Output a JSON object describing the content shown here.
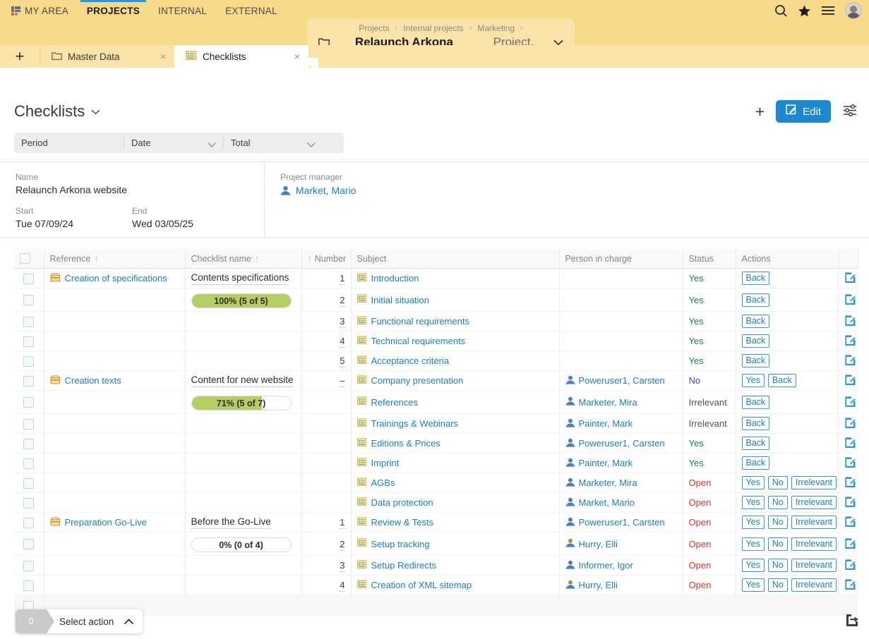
{
  "topnav": {
    "items": [
      {
        "label": "MY AREA",
        "icon": "myarea-icon",
        "active": false
      },
      {
        "label": "PROJECTS",
        "active": true
      },
      {
        "label": "INTERNAL",
        "active": false
      },
      {
        "label": "EXTERNAL",
        "active": false
      }
    ],
    "icons": [
      "search-icon",
      "star-icon",
      "menu-icon",
      "avatar"
    ]
  },
  "breadcrumb": {
    "path": [
      "Projects",
      "Internal projects",
      "Marketing"
    ],
    "separator": "›",
    "title": "Relaunch Arkona website",
    "subtitle": "Project, Open",
    "chevron": "⌄"
  },
  "tabs": {
    "add_label": "+",
    "items": [
      {
        "label": "Master Data",
        "icon": "folder-icon",
        "active": false,
        "close": "×"
      },
      {
        "label": "Checklists",
        "icon": "checklist-icon",
        "active": true,
        "close": "×"
      }
    ]
  },
  "page": {
    "title": "Checklists",
    "title_chevron": "⌄",
    "plus_label": "+",
    "edit_label": "Edit"
  },
  "filters": {
    "label": "Period",
    "date_value": "Date",
    "total_value": "Total"
  },
  "info": {
    "name_label": "Name",
    "name_value": "Relaunch Arkona website",
    "start_label": "Start",
    "start_value": "Tue 07/09/24",
    "end_label": "End",
    "end_value": "Wed 03/05/25",
    "pm_label": "Project manager",
    "pm_value": "Market, Mario"
  },
  "table": {
    "columns": [
      {
        "key": "ref",
        "label": "Reference",
        "sort": "↑",
        "sort_pos": "after"
      },
      {
        "key": "name",
        "label": "Checklist name",
        "sort": "↑",
        "sort_pos": "after"
      },
      {
        "key": "num",
        "label": "Number",
        "sort": "↑",
        "sort_pos": "before"
      },
      {
        "key": "subj",
        "label": "Subject",
        "sort": "",
        "sort_pos": ""
      },
      {
        "key": "pers",
        "label": "Person in charge",
        "sort": "",
        "sort_pos": ""
      },
      {
        "key": "stat",
        "label": "Status",
        "sort": "",
        "sort_pos": ""
      },
      {
        "key": "act",
        "label": "Actions",
        "sort": "",
        "sort_pos": ""
      }
    ],
    "groups": [
      {
        "reference": "Creation of specifications",
        "checklist_name": "Contents specifications",
        "progress_text": "100% (5 of 5)",
        "progress_percent": 100,
        "rows": [
          {
            "number": "1",
            "subject": "Introduction",
            "person": "",
            "person_type": "",
            "status": "Yes",
            "status_class": "st-yes",
            "actions": [
              "Back"
            ]
          },
          {
            "number": "2",
            "subject": "Initial situation",
            "person": "",
            "person_type": "",
            "status": "Yes",
            "status_class": "st-yes",
            "actions": [
              "Back"
            ]
          },
          {
            "number": "3",
            "subject": "Functional requirements",
            "person": "",
            "person_type": "",
            "status": "Yes",
            "status_class": "st-yes",
            "actions": [
              "Back"
            ]
          },
          {
            "number": "4",
            "subject": "Technical requirements",
            "person": "",
            "person_type": "",
            "status": "Yes",
            "status_class": "st-yes",
            "actions": [
              "Back"
            ]
          },
          {
            "number": "5",
            "subject": "Acceptance criteria",
            "person": "",
            "person_type": "",
            "status": "Yes",
            "status_class": "st-yes",
            "actions": [
              "Back"
            ]
          }
        ]
      },
      {
        "reference": "Creation texts",
        "checklist_name": "Content for new website",
        "progress_text": "71% (5 of 7)",
        "progress_percent": 71,
        "rows": [
          {
            "number": "–",
            "subject": "Company presentation",
            "person": "Poweruser1, Carsten",
            "person_type": "blue",
            "status": "No",
            "status_class": "st-no",
            "actions": [
              "Yes",
              "Back"
            ]
          },
          {
            "number": "",
            "subject": "References",
            "person": "Marketer, Mira",
            "person_type": "blue",
            "status": "Irrelevant",
            "status_class": "st-irr",
            "actions": [
              "Back"
            ]
          },
          {
            "number": "",
            "subject": "Trainings & Webinars",
            "person": "Painter, Mark",
            "person_type": "blue",
            "status": "Irrelevant",
            "status_class": "st-irr",
            "actions": [
              "Back"
            ]
          },
          {
            "number": "",
            "subject": "Editions & Prices",
            "person": "Poweruser1, Carsten",
            "person_type": "blue",
            "status": "Yes",
            "status_class": "st-yes",
            "actions": [
              "Back"
            ]
          },
          {
            "number": "",
            "subject": "Imprint",
            "person": "Painter, Mark",
            "person_type": "blue",
            "status": "Yes",
            "status_class": "st-yes",
            "actions": [
              "Back"
            ]
          },
          {
            "number": "",
            "subject": "AGBs",
            "person": "Marketer, Mira",
            "person_type": "blue",
            "status": "Open",
            "status_class": "st-open",
            "actions": [
              "Yes",
              "No",
              "Irrelevant"
            ]
          },
          {
            "number": "",
            "subject": "Data protection",
            "person": "Market, Mario",
            "person_type": "blue",
            "status": "Open",
            "status_class": "st-open",
            "actions": [
              "Yes",
              "No",
              "Irrelevant"
            ]
          }
        ]
      },
      {
        "reference": "Preparation Go-Live",
        "checklist_name": "Before the Go-Live",
        "progress_text": "0% (0 of 4)",
        "progress_percent": 0,
        "rows": [
          {
            "number": "1",
            "subject": "Review & Tests",
            "person": "Poweruser1, Carsten",
            "person_type": "blue",
            "status": "Open",
            "status_class": "st-open",
            "actions": [
              "Yes",
              "No",
              "Irrelevant"
            ]
          },
          {
            "number": "2",
            "subject": "Setup tracking",
            "person": "Hurry, Elli",
            "person_type": "green",
            "status": "Open",
            "status_class": "st-open",
            "actions": [
              "Yes",
              "No",
              "Irrelevant"
            ]
          },
          {
            "number": "3",
            "subject": "Setup Redirects",
            "person": "Informer, Igor",
            "person_type": "blue",
            "status": "Open",
            "status_class": "st-open",
            "actions": [
              "Yes",
              "No",
              "Irrelevant"
            ]
          },
          {
            "number": "4",
            "subject": "Creation of XML sitemap",
            "person": "Hurry, Elli",
            "person_type": "green",
            "status": "Open",
            "status_class": "st-open",
            "actions": [
              "Yes",
              "No",
              "Irrelevant"
            ]
          }
        ]
      }
    ]
  },
  "footer": {
    "count": "0",
    "select_action_label": "Select action",
    "caret": "⌃",
    "export_icon": "export-icon"
  },
  "colors": {
    "accent": "#1b88d1",
    "header_bg": "#f7d98a",
    "tab_bg": "#fae3a8",
    "progress_fill": "#b5cf63",
    "link": "#1b7fc4",
    "status_yes": "#17883d",
    "status_no": "#3d46d4",
    "status_open": "#e8312a",
    "status_irrelevant": "#555555"
  }
}
